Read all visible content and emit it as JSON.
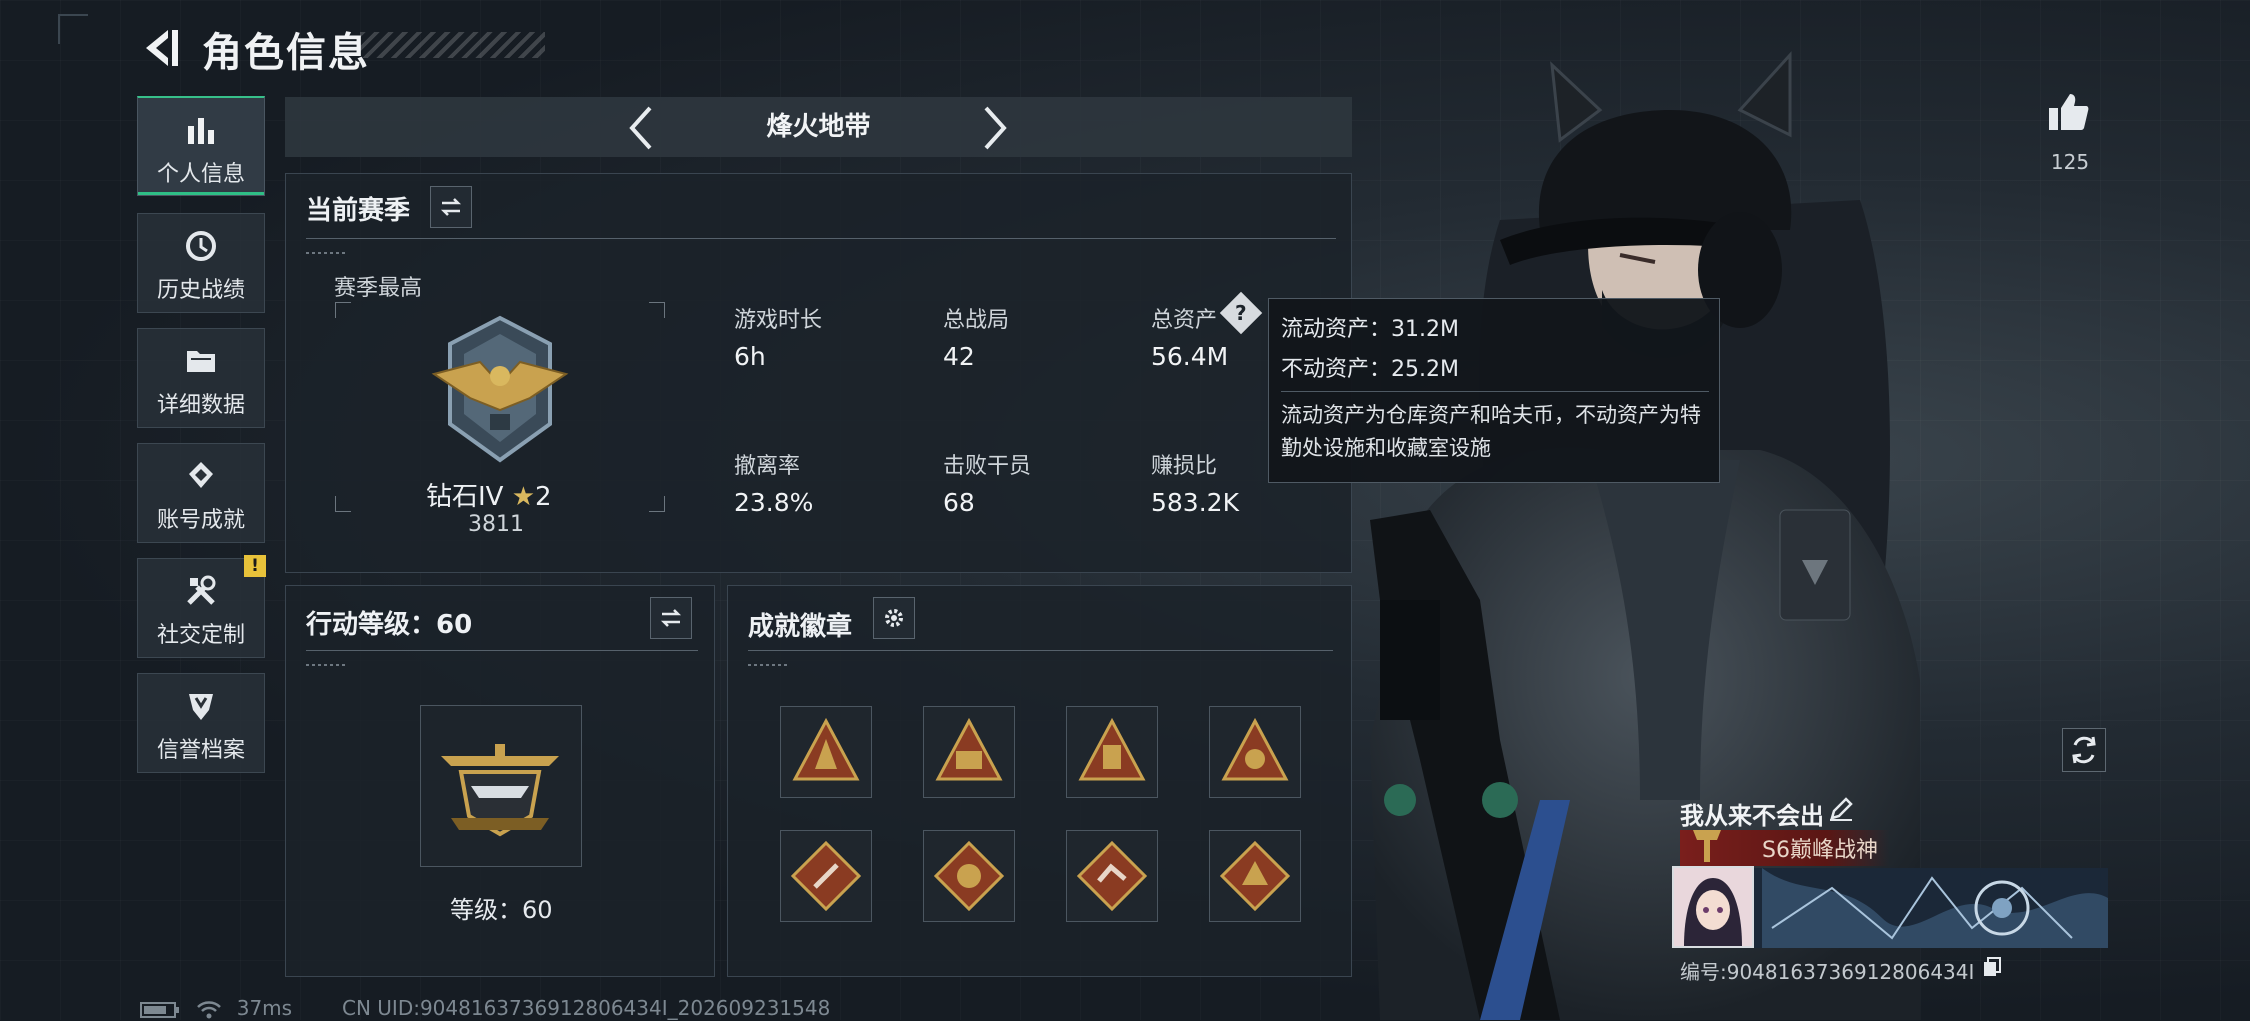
{
  "header": {
    "title": "角色信息"
  },
  "sidebar": {
    "items": [
      {
        "label": "个人信息",
        "icon": "bar-chart-icon"
      },
      {
        "label": "历史战绩",
        "icon": "history-icon"
      },
      {
        "label": "详细数据",
        "icon": "folder-icon"
      },
      {
        "label": "账号成就",
        "icon": "achievement-icon"
      },
      {
        "label": "社交定制",
        "icon": "tools-icon"
      },
      {
        "label": "信誉档案",
        "icon": "shield-icon"
      }
    ],
    "warning_badge": "!"
  },
  "mode_bar": {
    "label": "烽火地带"
  },
  "season_panel": {
    "title": "当前赛季",
    "best_label": "赛季最高",
    "rank_name": "钻石IV",
    "rank_stars": "2",
    "rank_points": "3811",
    "stats": [
      {
        "label": "游戏时长",
        "value": "6h"
      },
      {
        "label": "总战局",
        "value": "42"
      },
      {
        "label": "总资产",
        "value": "56.4M"
      },
      {
        "label": "撤离率",
        "value": "23.8%"
      },
      {
        "label": "击败干员",
        "value": "68"
      },
      {
        "label": "赚损比",
        "value": "583.2K"
      }
    ],
    "help_icon": "?"
  },
  "tooltip": {
    "liquid": "流动资产：31.2M",
    "fixed": "不动资产：25.2M",
    "description": "流动资产为仓库资产和哈夫币，不动资产为特勤处设施和收藏室设施"
  },
  "level_panel": {
    "title": "行动等级：60",
    "level_text": "等级：60"
  },
  "badge_panel": {
    "title": "成就徽章",
    "badges": [
      "badge-1",
      "badge-2",
      "badge-3",
      "badge-4",
      "badge-5",
      "badge-6",
      "badge-7",
      "badge-8"
    ]
  },
  "right": {
    "like_count": "125",
    "player_name": "我从来不会出",
    "player_title": "S6巅峰战神",
    "uid_line": "编号:9048163736912806434I"
  },
  "footer": {
    "ping": "37ms",
    "uid": "CN UID:9048163736912806434I_202609231548"
  },
  "colors": {
    "accent_green": "#2fbf86",
    "gold": "#c9a24f",
    "warning": "#e8c23a",
    "title_red": "#7a1f1c"
  }
}
